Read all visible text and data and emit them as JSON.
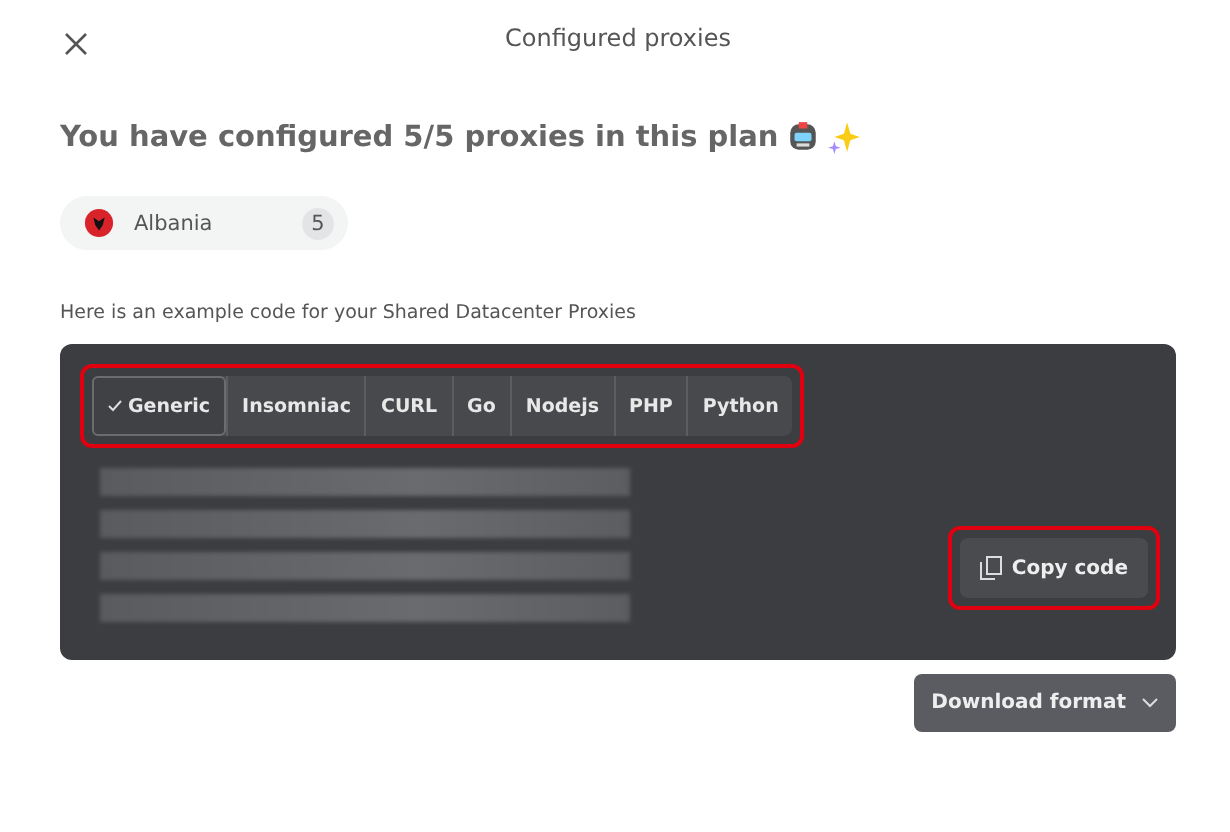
{
  "dialog": {
    "title": "Configured proxies"
  },
  "heading": "You have configured 5/5 proxies in this plan",
  "locations": [
    {
      "name": "Albania",
      "count": "5"
    }
  ],
  "intro": "Here is an example code for your Shared Datacenter Proxies",
  "code_tabs": {
    "highlighted": true,
    "tabs": [
      {
        "label": "Generic",
        "selected": true
      },
      {
        "label": "Insomniac",
        "selected": false
      },
      {
        "label": "CURL",
        "selected": false
      },
      {
        "label": "Go",
        "selected": false
      },
      {
        "label": "Nodejs",
        "selected": false
      },
      {
        "label": "PHP",
        "selected": false
      },
      {
        "label": "Python",
        "selected": false
      }
    ]
  },
  "copy_button": {
    "label": "Copy code",
    "highlighted": true
  },
  "download_button": {
    "label": "Download format"
  }
}
